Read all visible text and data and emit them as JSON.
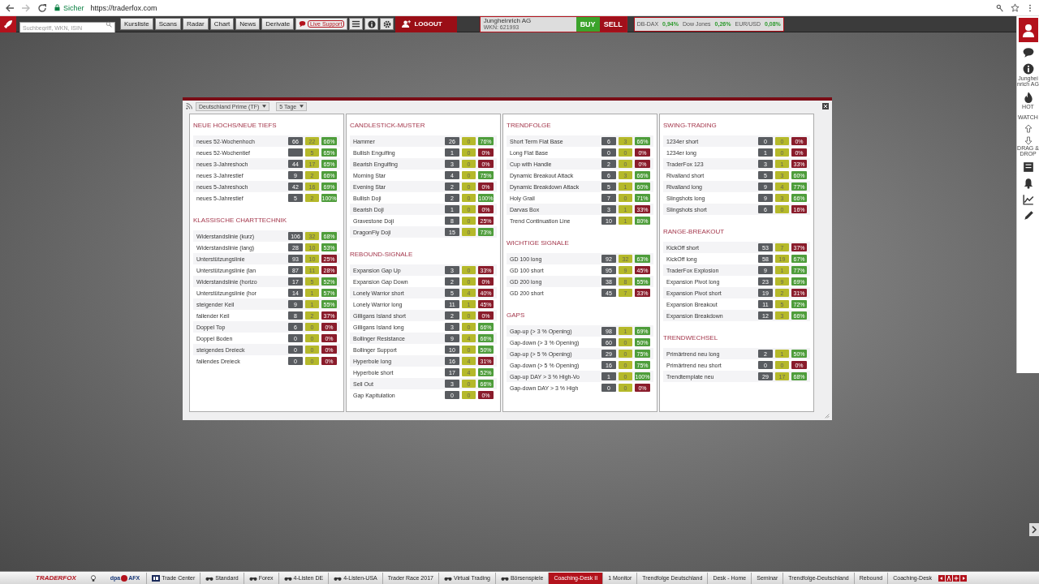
{
  "browser": {
    "security": "Sicher",
    "url": "https://traderfox.com"
  },
  "toolbar": {
    "search": {
      "placeholder": "Suchbegriff, WKN, ISIN"
    },
    "nav": [
      "Kursliste",
      "Scans",
      "Radar",
      "Chart",
      "News",
      "Derivate"
    ],
    "live_support": "Live Support",
    "logout": "LOGOUT",
    "stock": {
      "name": "Jungheinrich AG",
      "wkn": "WKN: 621993"
    },
    "buy": "BUY",
    "sell": "SELL",
    "tickers": [
      {
        "name": "DB-DAX",
        "change": "0,94%"
      },
      {
        "name": "Dow Jones",
        "change": "0,26%"
      },
      {
        "name": "EUR/USD",
        "change": "0,08%"
      }
    ]
  },
  "sidebar": {
    "items": [
      {
        "kind": "avatar"
      },
      {
        "kind": "chat"
      },
      {
        "kind": "info",
        "label": "Jungheinrich AG"
      },
      {
        "kind": "hot",
        "label": "HOT"
      },
      {
        "kind": "watch",
        "label": "WATCH"
      },
      {
        "kind": "drag",
        "label": "DRAG & DROP"
      },
      {
        "kind": "news"
      },
      {
        "kind": "bell"
      },
      {
        "kind": "chart"
      },
      {
        "kind": "pencil"
      }
    ]
  },
  "panel": {
    "filters": [
      "Deutschland Prime (TF)",
      "5 Tage"
    ],
    "columns": [
      {
        "sections": [
          {
            "title": "NEUE HOCHS/NEUE TIEFS",
            "rows": [
              {
                "name": "neues 52-Wochenhoch",
                "count": "66",
                "hits": "22",
                "rate": "66%",
                "color": "#4e9d3b"
              },
              {
                "name": "neues 52-Wochentief",
                "hits": "5",
                "rate": "65%",
                "color": "#4e9d3b"
              },
              {
                "name": "neues 3-Jahreshoch",
                "count": "44",
                "hits": "17",
                "rate": "65%",
                "color": "#4e9d3b"
              },
              {
                "name": "neues 3-Jahrestief",
                "count": "9",
                "hits": "2",
                "rate": "66%",
                "color": "#4e9d3b"
              },
              {
                "name": "neues 5-Jahreshoch",
                "count": "42",
                "hits": "16",
                "rate": "69%",
                "color": "#4e9d3b"
              },
              {
                "name": "neues 5-Jahrestief",
                "count": "5",
                "hits": "2",
                "rate": "100%",
                "color": "#4e9d3b"
              }
            ]
          },
          {
            "title": "KLASSISCHE CHARTTECHNIK",
            "rows": [
              {
                "name": "Widerstandslinie (kurz)",
                "count": "106",
                "hits": "32",
                "rate": "68%",
                "color": "#4e9d3b"
              },
              {
                "name": "Widerstandslinie (lang)",
                "count": "28",
                "hits": "10",
                "rate": "53%",
                "color": "#4e9d3b"
              },
              {
                "name": "Unterstützungslinie",
                "count": "93",
                "hits": "10",
                "rate": "25%",
                "color": "#8a1c2b"
              },
              {
                "name": "Unterstützungslinie (lan",
                "count": "87",
                "hits": "11",
                "rate": "28%",
                "color": "#8a1c2b"
              },
              {
                "name": "Widerstandslinie (horizo",
                "count": "17",
                "hits": "5",
                "rate": "52%",
                "color": "#4e9d3b"
              },
              {
                "name": "Unterstützungslinie (hor",
                "count": "14",
                "hits": "1",
                "rate": "57%",
                "color": "#4e9d3b"
              },
              {
                "name": "steigender Keil",
                "count": "9",
                "hits": "1",
                "rate": "55%",
                "color": "#4e9d3b"
              },
              {
                "name": "fallender Keil",
                "count": "8",
                "hits": "2",
                "rate": "37%",
                "color": "#8a1c2b"
              },
              {
                "name": "Doppel Top",
                "count": "6",
                "hits": "0",
                "rate": "0%",
                "color": "#8a1c2b"
              },
              {
                "name": "Doppel Boden",
                "count": "0",
                "hits": "0",
                "rate": "0%",
                "color": "#8a1c2b"
              },
              {
                "name": "steigendes Dreieck",
                "count": "0",
                "hits": "0",
                "rate": "0%",
                "color": "#8a1c2b"
              },
              {
                "name": "fallendes Dreieck",
                "count": "0",
                "hits": "0",
                "rate": "0%",
                "color": "#8a1c2b"
              }
            ]
          }
        ]
      },
      {
        "sections": [
          {
            "title": "CANDLESTICK-MUSTER",
            "rows": [
              {
                "name": "Hammer",
                "count": "26",
                "hits": "0",
                "rate": "76%",
                "color": "#4e9d3b"
              },
              {
                "name": "Bullish Engulfing",
                "count": "1",
                "hits": "0",
                "rate": "0%",
                "color": "#8a1c2b"
              },
              {
                "name": "Bearish Engulfing",
                "count": "3",
                "hits": "0",
                "rate": "0%",
                "color": "#8a1c2b"
              },
              {
                "name": "Morning Star",
                "count": "4",
                "hits": "0",
                "rate": "75%",
                "color": "#4e9d3b"
              },
              {
                "name": "Evening Star",
                "count": "2",
                "hits": "0",
                "rate": "0%",
                "color": "#8a1c2b"
              },
              {
                "name": "Bullish Doji",
                "count": "2",
                "hits": "0",
                "rate": "100%",
                "color": "#4e9d3b"
              },
              {
                "name": "Bearish Doji",
                "count": "1",
                "hits": "0",
                "rate": "0%",
                "color": "#8a1c2b"
              },
              {
                "name": "Gravestone Doji",
                "count": "8",
                "hits": "0",
                "rate": "25%",
                "color": "#8a1c2b"
              },
              {
                "name": "DragonFly Doji",
                "count": "15",
                "hits": "0",
                "rate": "73%",
                "color": "#4e9d3b"
              }
            ]
          },
          {
            "title": "REBOUND-SIGNALE",
            "rows": [
              {
                "name": "Expansion Gap Up",
                "count": "3",
                "hits": "0",
                "rate": "33%",
                "color": "#8a1c2b"
              },
              {
                "name": "Expansion Gap Down",
                "count": "2",
                "hits": "0",
                "rate": "0%",
                "color": "#8a1c2b"
              },
              {
                "name": "Lonely Warrior short",
                "count": "5",
                "hits": "4",
                "rate": "40%",
                "color": "#8a1c2b"
              },
              {
                "name": "Lonely Warrior long",
                "count": "11",
                "hits": "1",
                "rate": "45%",
                "color": "#8a1c2b"
              },
              {
                "name": "Gilligans Island short",
                "count": "2",
                "hits": "0",
                "rate": "0%",
                "color": "#8a1c2b"
              },
              {
                "name": "Gilligans Island long",
                "count": "3",
                "hits": "0",
                "rate": "66%",
                "color": "#4e9d3b"
              },
              {
                "name": "Bollinger Resistance",
                "count": "9",
                "hits": "4",
                "rate": "66%",
                "color": "#4e9d3b"
              },
              {
                "name": "Bollinger Support",
                "count": "10",
                "hits": "0",
                "rate": "50%",
                "color": "#4e9d3b"
              },
              {
                "name": "Hyperbole long",
                "count": "16",
                "hits": "4",
                "rate": "31%",
                "color": "#8a1c2b"
              },
              {
                "name": "Hyperbole short",
                "count": "17",
                "hits": "4",
                "rate": "52%",
                "color": "#4e9d3b"
              },
              {
                "name": "Sell Out",
                "count": "3",
                "hits": "0",
                "rate": "66%",
                "color": "#4e9d3b"
              },
              {
                "name": "Gap Kapitulation",
                "count": "0",
                "hits": "0",
                "rate": "0%",
                "color": "#8a1c2b"
              }
            ]
          }
        ]
      },
      {
        "sections": [
          {
            "title": "TRENDFOLGE",
            "rows": [
              {
                "name": "Short Term Flat Base",
                "count": "6",
                "hits": "3",
                "rate": "66%",
                "color": "#4e9d3b"
              },
              {
                "name": "Long Flat Base",
                "count": "0",
                "hits": "0",
                "rate": "0%",
                "color": "#8a1c2b"
              },
              {
                "name": "Cup with Handle",
                "count": "2",
                "hits": "0",
                "rate": "0%",
                "color": "#8a1c2b"
              },
              {
                "name": "Dynamic Breakout Attack",
                "count": "6",
                "hits": "3",
                "rate": "66%",
                "color": "#4e9d3b"
              },
              {
                "name": "Dynamic Breakdown Attack",
                "count": "5",
                "hits": "1",
                "rate": "60%",
                "color": "#4e9d3b"
              },
              {
                "name": "Holy Grail",
                "count": "7",
                "hits": "0",
                "rate": "71%",
                "color": "#4e9d3b"
              },
              {
                "name": "Darvas Box",
                "count": "3",
                "hits": "1",
                "rate": "33%",
                "color": "#8a1c2b"
              },
              {
                "name": "Trend Continuation Line",
                "count": "10",
                "hits": "1",
                "rate": "80%",
                "color": "#4e9d3b"
              }
            ]
          },
          {
            "title": "WICHTIGE SIGNALE",
            "rows": [
              {
                "name": "GD 100 long",
                "count": "92",
                "hits": "32",
                "rate": "63%",
                "color": "#4e9d3b"
              },
              {
                "name": "GD 100 short",
                "count": "95",
                "hits": "9",
                "rate": "45%",
                "color": "#8a1c2b"
              },
              {
                "name": "GD 200 long",
                "count": "38",
                "hits": "8",
                "rate": "55%",
                "color": "#4e9d3b"
              },
              {
                "name": "GD 200 short",
                "count": "45",
                "hits": "7",
                "rate": "33%",
                "color": "#8a1c2b"
              }
            ]
          },
          {
            "title": "GAPS",
            "rows": [
              {
                "name": "Gap-up (> 3 % Opening)",
                "count": "98",
                "hits": "1",
                "rate": "69%",
                "color": "#4e9d3b"
              },
              {
                "name": "Gap-down (> 3 % Opening)",
                "count": "60",
                "hits": "0",
                "rate": "50%",
                "color": "#4e9d3b"
              },
              {
                "name": "Gap-up (> 5 % Opening)",
                "count": "29",
                "hits": "0",
                "rate": "75%",
                "color": "#4e9d3b"
              },
              {
                "name": "Gap-down (> 5 % Opening)",
                "count": "16",
                "hits": "0",
                "rate": "75%",
                "color": "#4e9d3b"
              },
              {
                "name": "Gap-up DAY > 3 % High-Vo",
                "count": "1",
                "hits": "0",
                "rate": "100%",
                "color": "#4e9d3b"
              },
              {
                "name": "Gap-down DAY > 3 % High",
                "count": "0",
                "hits": "0",
                "rate": "0%",
                "color": "#8a1c2b"
              }
            ]
          }
        ]
      },
      {
        "sections": [
          {
            "title": "SWING-TRADING",
            "rows": [
              {
                "name": "1234er short",
                "count": "0",
                "hits": "0",
                "rate": "0%",
                "color": "#8a1c2b"
              },
              {
                "name": "1234er long",
                "count": "1",
                "hits": "0",
                "rate": "0%",
                "color": "#8a1c2b"
              },
              {
                "name": "TraderFox 123",
                "count": "3",
                "hits": "1",
                "rate": "33%",
                "color": "#8a1c2b"
              },
              {
                "name": "Rivalland short",
                "count": "5",
                "hits": "3",
                "rate": "60%",
                "color": "#4e9d3b"
              },
              {
                "name": "Rivalland long",
                "count": "9",
                "hits": "4",
                "rate": "77%",
                "color": "#4e9d3b"
              },
              {
                "name": "Slingshots long",
                "count": "9",
                "hits": "3",
                "rate": "66%",
                "color": "#4e9d3b"
              },
              {
                "name": "Slingshots short",
                "count": "6",
                "hits": "0",
                "rate": "16%",
                "color": "#8a1c2b"
              }
            ]
          },
          {
            "title": "RANGE-BREAKOUT",
            "rows": [
              {
                "name": "KickOff short",
                "count": "53",
                "hits": "7",
                "rate": "37%",
                "color": "#8a1c2b"
              },
              {
                "name": "KickOff long",
                "count": "58",
                "hits": "19",
                "rate": "67%",
                "color": "#4e9d3b"
              },
              {
                "name": "TraderFox Explosion",
                "count": "9",
                "hits": "1",
                "rate": "77%",
                "color": "#4e9d3b"
              },
              {
                "name": "Expansion Pivot long",
                "count": "23",
                "hits": "9",
                "rate": "69%",
                "color": "#4e9d3b"
              },
              {
                "name": "Expansion Pivot short",
                "count": "19",
                "hits": "2",
                "rate": "31%",
                "color": "#8a1c2b"
              },
              {
                "name": "Expansion Breakout",
                "count": "11",
                "hits": "5",
                "rate": "72%",
                "color": "#4e9d3b"
              },
              {
                "name": "Expansion Breakdown",
                "count": "12",
                "hits": "3",
                "rate": "66%",
                "color": "#4e9d3b"
              }
            ]
          },
          {
            "title": "TRENDWECHSEL",
            "rows": [
              {
                "name": "Primärtrend neu long",
                "count": "2",
                "hits": "1",
                "rate": "50%",
                "color": "#4e9d3b"
              },
              {
                "name": "Primärtrend neu short",
                "count": "0",
                "hits": "0",
                "rate": "0%",
                "color": "#8a1c2b"
              },
              {
                "name": "Trendtemplate neu",
                "count": "29",
                "hits": "17",
                "rate": "68%",
                "color": "#4e9d3b"
              }
            ]
          }
        ]
      }
    ]
  },
  "taskbar": {
    "logo": "TRADERFOX",
    "dpa": [
      "dpa",
      "AFX"
    ],
    "tabs": [
      {
        "label": "Trade Center",
        "kind": "ls",
        "selected": false
      },
      {
        "label": "Standard",
        "kind": "eye",
        "selected": false
      },
      {
        "label": "Forex",
        "kind": "eye",
        "selected": false
      },
      {
        "label": "4-Listen DE",
        "kind": "eye",
        "selected": false
      },
      {
        "label": "4-Listen-USA",
        "kind": "eye",
        "selected": false
      },
      {
        "label": "Trader Race 2017",
        "kind": "plain",
        "selected": false
      },
      {
        "label": "Virtual Trading",
        "kind": "eye",
        "selected": false
      },
      {
        "label": "Börsenspiele",
        "kind": "eye",
        "selected": false
      },
      {
        "label": "Coaching-Desk II",
        "kind": "plain",
        "selected": true
      },
      {
        "label": "1 Monitor",
        "kind": "plain",
        "selected": false
      },
      {
        "label": "Trendfolge Deutschland",
        "kind": "plain",
        "selected": false
      },
      {
        "label": "Desk - Home",
        "kind": "plain",
        "selected": false
      },
      {
        "label": "Seminar",
        "kind": "plain",
        "selected": false
      },
      {
        "label": "Trendfolge-Deutschland",
        "kind": "plain",
        "selected": false
      },
      {
        "label": "Rebound",
        "kind": "plain",
        "selected": false
      },
      {
        "label": "Coaching-Desk",
        "kind": "plain",
        "selected": false
      }
    ]
  }
}
